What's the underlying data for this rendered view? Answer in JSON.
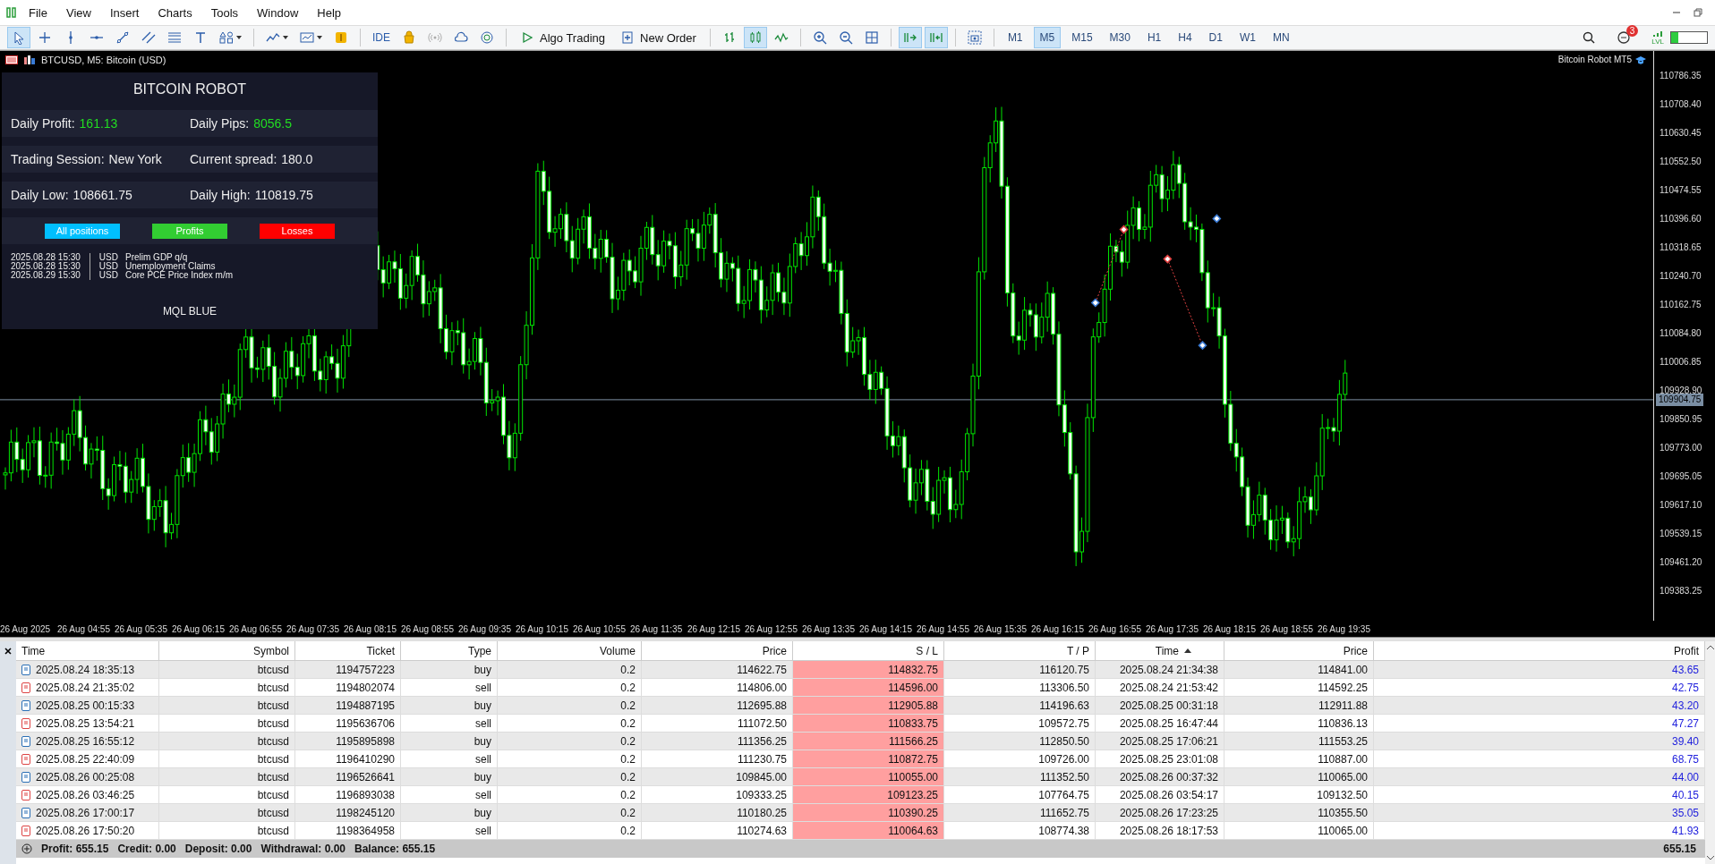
{
  "menu": [
    "File",
    "View",
    "Insert",
    "Charts",
    "Tools",
    "Window",
    "Help"
  ],
  "toolbar": {
    "groups": [
      [
        {
          "kind": "cursor",
          "selected": true
        },
        {
          "kind": "crosshair",
          "selected": false
        },
        {
          "kind": "vline",
          "selected": false
        },
        {
          "kind": "hline",
          "selected": false
        },
        {
          "kind": "trendline",
          "selected": false
        },
        {
          "kind": "channel",
          "selected": false
        },
        {
          "kind": "fibo",
          "selected": false
        },
        {
          "kind": "textTool",
          "selected": false
        },
        {
          "kind": "shapes",
          "selected": false
        }
      ],
      [
        {
          "kind": "indicators",
          "selected": false
        },
        {
          "kind": "templates",
          "selected": false
        },
        {
          "kind": "coin",
          "selected": false
        }
      ],
      [
        {
          "kind": "label",
          "text": "IDE",
          "selected": false
        },
        {
          "kind": "bag",
          "selected": false
        },
        {
          "kind": "radio",
          "selected": false
        },
        {
          "kind": "cloud",
          "selected": false
        },
        {
          "kind": "vps",
          "selected": false
        }
      ],
      [
        {
          "kind": "algo",
          "text": "Algo Trading",
          "selected": false
        },
        {
          "kind": "neworder",
          "text": "New Order",
          "selected": false
        }
      ],
      [
        {
          "kind": "bars",
          "selected": false
        },
        {
          "kind": "candles",
          "selected": true
        },
        {
          "kind": "linechart",
          "selected": false
        }
      ],
      [
        {
          "kind": "zoomin",
          "selected": false
        },
        {
          "kind": "zoomout",
          "selected": false
        },
        {
          "kind": "grid",
          "selected": false
        }
      ],
      [
        {
          "kind": "autoscroll",
          "selected": true
        },
        {
          "kind": "shift",
          "selected": true
        }
      ],
      [
        {
          "kind": "screenshot",
          "selected": false
        }
      ]
    ],
    "timeframes": [
      {
        "label": "M1",
        "selected": false
      },
      {
        "label": "M5",
        "selected": true
      },
      {
        "label": "M15",
        "selected": false
      },
      {
        "label": "M30",
        "selected": false
      },
      {
        "label": "H1",
        "selected": false
      },
      {
        "label": "H4",
        "selected": false
      },
      {
        "label": "D1",
        "selected": false
      },
      {
        "label": "W1",
        "selected": false
      },
      {
        "label": "MN",
        "selected": false
      }
    ],
    "notifications": "3",
    "signal_label": "LVL"
  },
  "chart": {
    "title": "BTCUSD, M5:  Bitcoin (USD)",
    "expert": "Bitcoin Robot MT5",
    "price_labels": [
      "110786.35",
      "110708.40",
      "110630.45",
      "110552.50",
      "110474.55",
      "110396.60",
      "110318.65",
      "110240.70",
      "110162.75",
      "110084.80",
      "110006.85",
      "109928.90",
      "109850.95",
      "109773.00",
      "109695.05",
      "109617.10",
      "109539.15",
      "109461.20",
      "109383.25"
    ],
    "current_price": "109904.75",
    "time_labels": [
      "26 Aug 2025",
      "26 Aug 04:55",
      "26 Aug 05:35",
      "26 Aug 06:15",
      "26 Aug 06:55",
      "26 Aug 07:35",
      "26 Aug 08:15",
      "26 Aug 08:55",
      "26 Aug 09:35",
      "26 Aug 10:15",
      "26 Aug 10:55",
      "26 Aug 11:35",
      "26 Aug 12:15",
      "26 Aug 12:55",
      "26 Aug 13:35",
      "26 Aug 14:15",
      "26 Aug 14:55",
      "26 Aug 15:35",
      "26 Aug 16:15",
      "26 Aug 16:55",
      "26 Aug 17:35",
      "26 Aug 18:15",
      "26 Aug 18:55",
      "26 Aug 19:35"
    ]
  },
  "panel": {
    "title": "BITCOIN ROBOT",
    "rows": [
      [
        {
          "label": "Daily Profit:",
          "value": "161.13",
          "highlight": true
        },
        {
          "label": "Daily Pips:",
          "value": "8056.5",
          "highlight": true
        }
      ],
      [
        {
          "label": "Trading Session:",
          "value": "New York",
          "highlight": false
        },
        {
          "label": "Current spread:",
          "value": "180.0",
          "highlight": false
        }
      ],
      [
        {
          "label": "Daily Low:",
          "value": "108661.75",
          "highlight": false
        },
        {
          "label": "Daily High:",
          "value": "110819.75",
          "highlight": false
        }
      ]
    ],
    "buttons": [
      {
        "label": "All positions",
        "color": "#00bfff"
      },
      {
        "label": "Profits",
        "color": "#32cd32"
      },
      {
        "label": "Losses",
        "color": "#ff0000"
      }
    ],
    "news": [
      {
        "time": "2025.08.28 15:30",
        "currency": "USD",
        "event": "Prelim GDP q/q"
      },
      {
        "time": "2025.08.28 15:30",
        "currency": "USD",
        "event": "Unemployment Claims"
      },
      {
        "time": "2025.08.29 15:30",
        "currency": "USD",
        "event": "Core PCE Price Index m/m"
      }
    ],
    "footer": "MQL BLUE"
  },
  "table": {
    "columns": [
      {
        "label": "Time",
        "sorted": false
      },
      {
        "label": "Symbol",
        "sorted": false
      },
      {
        "label": "Ticket",
        "sorted": false
      },
      {
        "label": "Type",
        "sorted": false
      },
      {
        "label": "Volume",
        "sorted": false
      },
      {
        "label": "Price",
        "sorted": false
      },
      {
        "label": "S / L",
        "sorted": false
      },
      {
        "label": "T / P",
        "sorted": false
      },
      {
        "label": "Time",
        "sorted": true
      },
      {
        "label": "Price",
        "sorted": false
      },
      {
        "label": "Profit",
        "sorted": false
      }
    ],
    "rows": [
      {
        "kind": "buy",
        "cells": [
          "2025.08.24 18:35:13",
          "btcusd",
          "1194757223",
          "buy",
          "0.2",
          "114622.75",
          "114832.75",
          "116120.75",
          "2025.08.24 21:34:38",
          "114841.00",
          "43.65"
        ]
      },
      {
        "kind": "sell",
        "cells": [
          "2025.08.24 21:35:02",
          "btcusd",
          "1194802074",
          "sell",
          "0.2",
          "114806.00",
          "114596.00",
          "113306.50",
          "2025.08.24 21:53:42",
          "114592.25",
          "42.75"
        ]
      },
      {
        "kind": "buy",
        "cells": [
          "2025.08.25 00:15:33",
          "btcusd",
          "1194887195",
          "buy",
          "0.2",
          "112695.88",
          "112905.88",
          "114196.63",
          "2025.08.25 00:31:18",
          "112911.88",
          "43.20"
        ]
      },
      {
        "kind": "sell",
        "cells": [
          "2025.08.25 13:54:21",
          "btcusd",
          "1195636706",
          "sell",
          "0.2",
          "111072.50",
          "110833.75",
          "109572.75",
          "2025.08.25 16:47:44",
          "110836.13",
          "47.27"
        ]
      },
      {
        "kind": "buy",
        "cells": [
          "2025.08.25 16:55:12",
          "btcusd",
          "1195895898",
          "buy",
          "0.2",
          "111356.25",
          "111566.25",
          "112850.50",
          "2025.08.25 17:06:21",
          "111553.25",
          "39.40"
        ]
      },
      {
        "kind": "sell",
        "cells": [
          "2025.08.25 22:40:09",
          "btcusd",
          "1196410290",
          "sell",
          "0.2",
          "111230.75",
          "110872.75",
          "109726.00",
          "2025.08.25 23:01:08",
          "110887.00",
          "68.75"
        ]
      },
      {
        "kind": "buy",
        "cells": [
          "2025.08.26 00:25:08",
          "btcusd",
          "1196526641",
          "buy",
          "0.2",
          "109845.00",
          "110055.00",
          "111352.50",
          "2025.08.26 00:37:32",
          "110065.00",
          "44.00"
        ]
      },
      {
        "kind": "sell",
        "cells": [
          "2025.08.26 03:46:25",
          "btcusd",
          "1196893038",
          "sell",
          "0.2",
          "109333.25",
          "109123.25",
          "107764.75",
          "2025.08.26 03:54:17",
          "109132.50",
          "40.15"
        ]
      },
      {
        "kind": "buy",
        "cells": [
          "2025.08.26 17:00:17",
          "btcusd",
          "1198245120",
          "buy",
          "0.2",
          "110180.25",
          "110390.25",
          "111652.75",
          "2025.08.26 17:23:25",
          "110355.50",
          "35.05"
        ]
      },
      {
        "kind": "sell",
        "cells": [
          "2025.08.26 17:50:20",
          "btcusd",
          "1198364958",
          "sell",
          "0.2",
          "110274.63",
          "110064.63",
          "108774.38",
          "2025.08.26 18:17:53",
          "110065.00",
          "41.93"
        ]
      }
    ],
    "summary": [
      {
        "label": "Profit:",
        "value": "655.15"
      },
      {
        "label": "Credit:",
        "value": "0.00"
      },
      {
        "label": "Deposit:",
        "value": "0.00"
      },
      {
        "label": "Withdrawal:",
        "value": "0.00"
      },
      {
        "label": "Balance:",
        "value": "655.15"
      }
    ],
    "total": "655.15"
  }
}
